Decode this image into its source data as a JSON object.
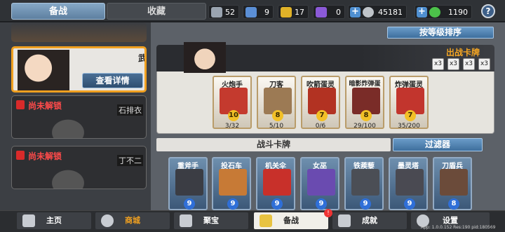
{
  "tabs": {
    "prep": "备战",
    "collect": "收藏"
  },
  "resources": [
    {
      "name": "shield-silver",
      "value": "52",
      "color": "#9aa4b0"
    },
    {
      "name": "shield-blue",
      "value": "9",
      "color": "#5b8fd6"
    },
    {
      "name": "shield-gold",
      "value": "17",
      "color": "#e0b228"
    },
    {
      "name": "shield-purple",
      "value": "0",
      "color": "#8b5ad8"
    },
    {
      "name": "silver-coin",
      "value": "45181",
      "color": "#bfc4c9"
    },
    {
      "name": "green-gem",
      "value": "1190",
      "color": "#4cc24a"
    }
  ],
  "help": "?",
  "hero_selected": {
    "name": "武",
    "detail_button": "查看详情"
  },
  "locked_heroes": [
    {
      "label": "尚未解锁",
      "name": "石排衣"
    },
    {
      "label": "尚未解锁",
      "name": "丁不二"
    }
  ],
  "sort_button": "按等级排序",
  "battle_section": {
    "title": "出战卡牌",
    "skills": [
      "x3",
      "x3",
      "x3",
      "x3"
    ],
    "cards": [
      {
        "name": "火炮手",
        "cost": "10",
        "count": "3/32",
        "color": "#c43a2e"
      },
      {
        "name": "刀客",
        "cost": "8",
        "count": "5/10",
        "color": "#9c7a54"
      },
      {
        "name": "吹箭蛋灵",
        "cost": "7",
        "count": "0/6",
        "color": "#b23222"
      },
      {
        "name": "暗影炸弹蛋灵",
        "cost": "8",
        "count": "29/100",
        "color": "#7a2c28"
      },
      {
        "name": "炸弹蛋灵",
        "cost": "7",
        "count": "35/200",
        "color": "#c2352d"
      }
    ]
  },
  "fight_section": {
    "title": "战斗卡牌",
    "filter_button": "过滤器",
    "cards": [
      {
        "name": "重斧手",
        "cost": "9",
        "color": "#3b3d44"
      },
      {
        "name": "投石车",
        "cost": "9",
        "color": "#c77a36"
      },
      {
        "name": "机关伞",
        "cost": "9",
        "color": "#c8302a"
      },
      {
        "name": "女巫",
        "cost": "9",
        "color": "#6a4bb0"
      },
      {
        "name": "铁蒺藜",
        "cost": "9",
        "color": "#4b4e55"
      },
      {
        "name": "墨灵塔",
        "cost": "9",
        "color": "#4a4a52"
      },
      {
        "name": "刀盾兵",
        "cost": "8",
        "color": "#6b4b3a"
      }
    ]
  },
  "nav": {
    "home": "主页",
    "shop": "商城",
    "treasure": "聚宝",
    "prep": "备战",
    "prep_badge": "!",
    "achievements": "成就",
    "settings": "设置"
  },
  "version": "App: 1.0.0.152 Res:190 pid:180569"
}
